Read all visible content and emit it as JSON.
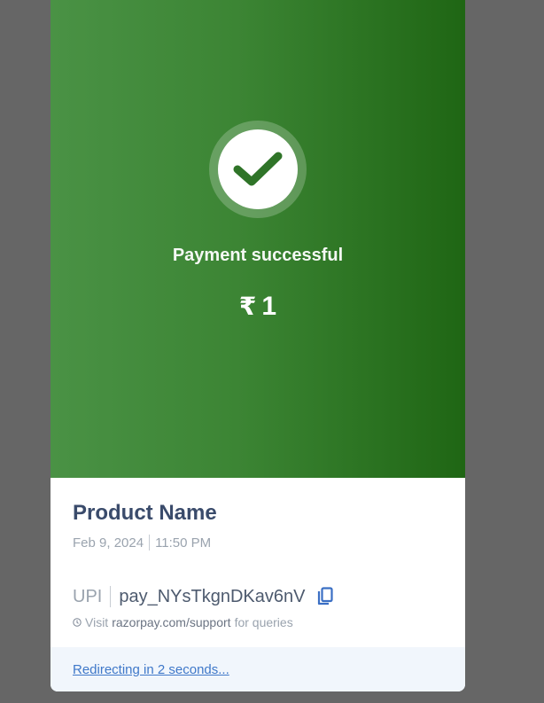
{
  "hero": {
    "status": "Payment successful",
    "currency_symbol": "₹",
    "amount": "1",
    "icon": "checkmark-icon",
    "colors": {
      "gradient_start": "#4a9245",
      "gradient_end": "#1f6614",
      "check": "#2f7428"
    }
  },
  "details": {
    "product_name": "Product Name",
    "date": "Feb 9, 2024",
    "time": "11:50 PM",
    "method": "UPI",
    "payment_id": "pay_NYsTkgnDKav6nV",
    "copy_icon": "copy-icon",
    "support": {
      "prefix": "Visit",
      "link": "razorpay.com/support",
      "suffix": "for queries",
      "icon": "info-icon"
    }
  },
  "footer": {
    "redirect_text": "Redirecting in 2 seconds..."
  }
}
